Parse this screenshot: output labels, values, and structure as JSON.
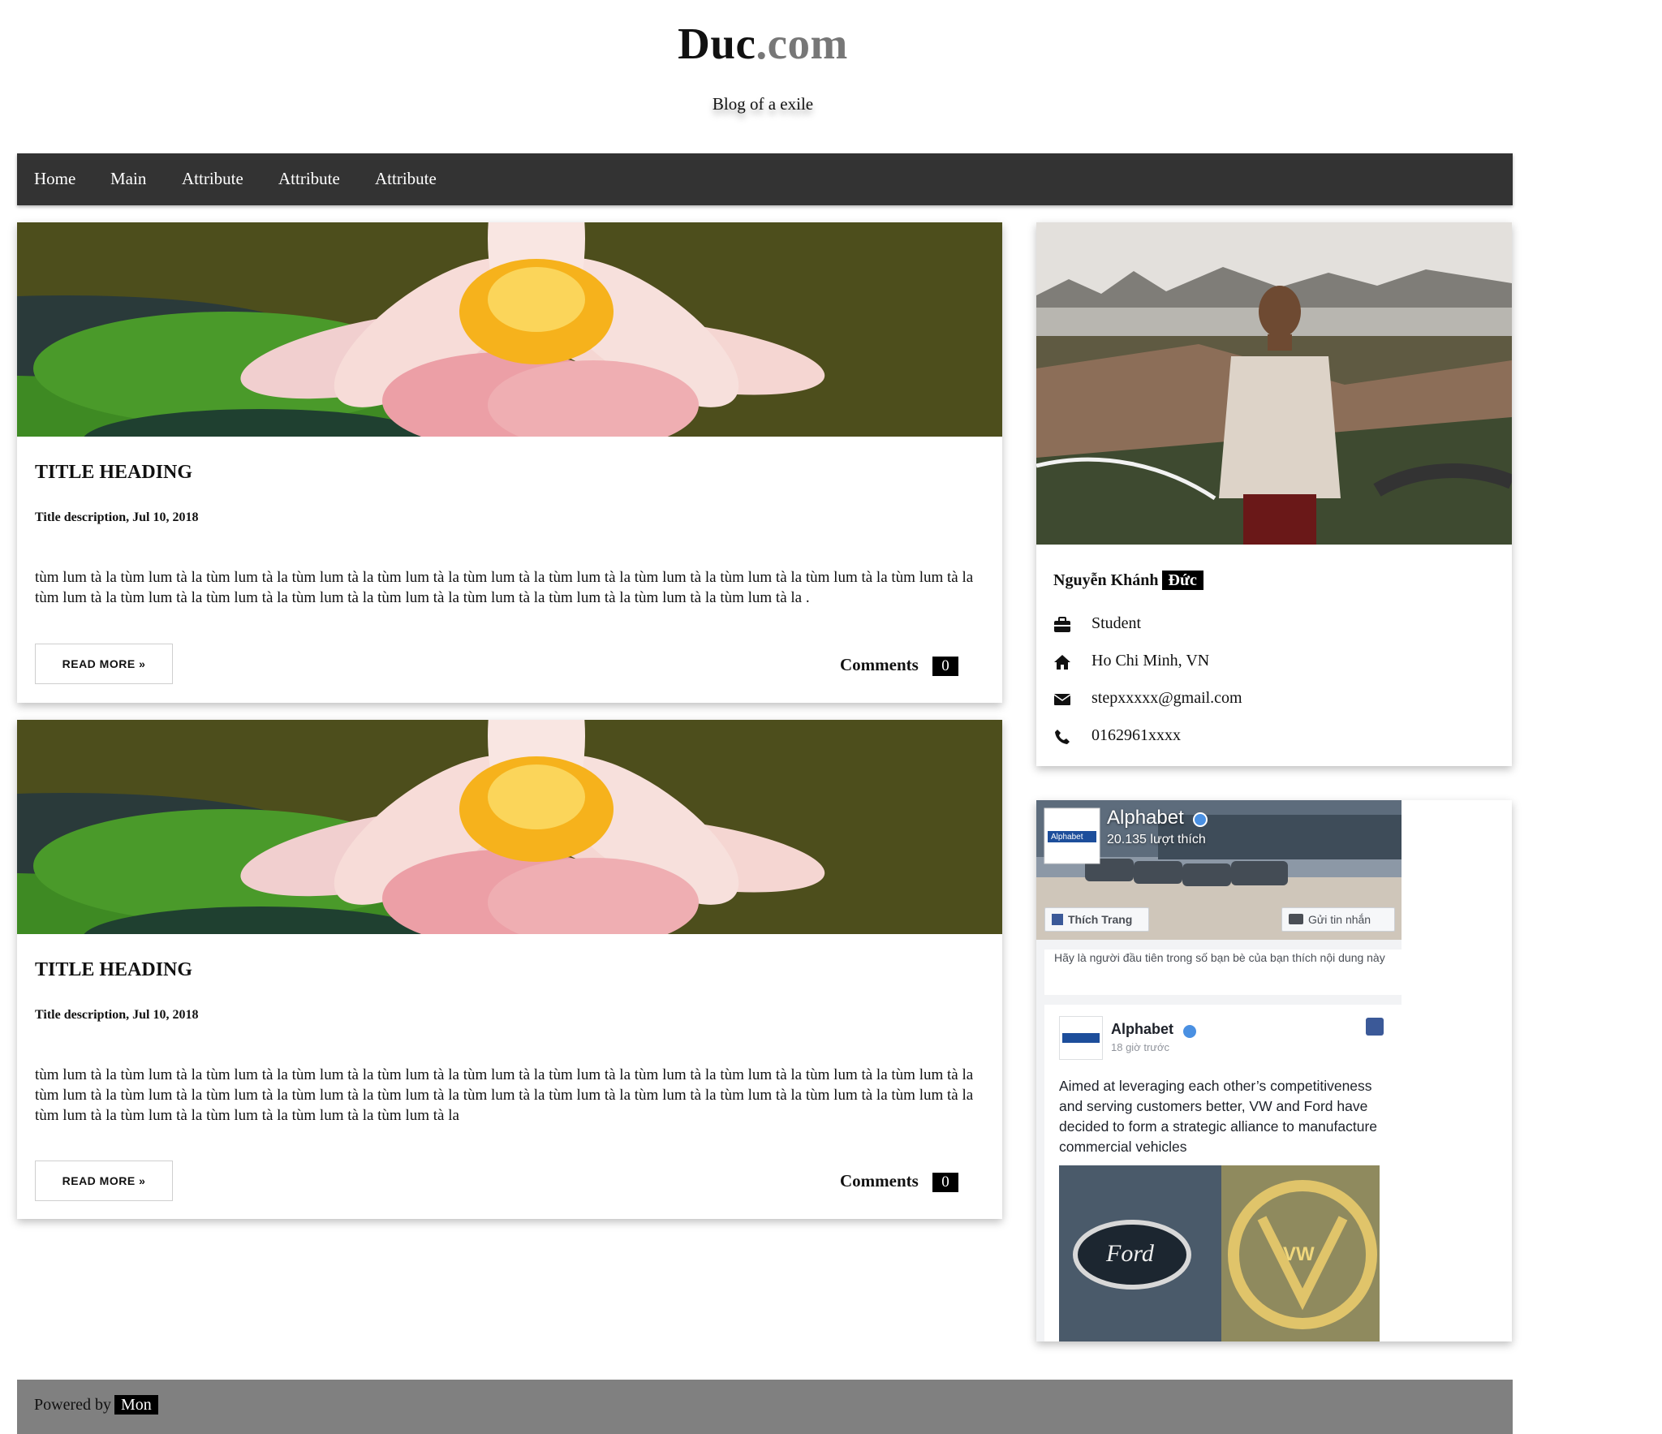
{
  "site": {
    "title_main": "Duc",
    "title_ext": ".com",
    "tagline": "Blog of a exile"
  },
  "nav": {
    "items": [
      "Home",
      "Main",
      "Attribute",
      "Attribute",
      "Attribute"
    ]
  },
  "posts": [
    {
      "title": "TITLE HEADING",
      "description": "Title description, Jul 10, 2018",
      "body": "tùm lum tà la tùm lum tà la tùm lum tà la tùm lum tà la tùm lum tà la tùm lum tà la tùm lum tà la tùm lum tà la tùm lum tà la tùm lum tà la tùm lum tà la tùm lum tà la tùm lum tà la tùm lum tà la tùm lum tà la tùm lum tà la tùm lum tà la tùm lum tà la tùm lum tà la tùm lum tà la .",
      "read_more": "READ MORE »",
      "comments_label": "Comments",
      "comments_count": "0"
    },
    {
      "title": "TITLE HEADING",
      "description": "Title description, Jul 10, 2018",
      "body": "tùm lum tà la tùm lum tà la tùm lum tà la tùm lum tà la tùm lum tà la tùm lum tà la tùm lum tà la tùm lum tà la tùm lum tà la tùm lum tà la tùm lum tà la tùm lum tà la tùm lum tà la tùm lum tà la tùm lum tà la tùm lum tà la tùm lum tà la tùm lum tà la tùm lum tà la tùm lum tà la tùm lum tà la tùm lum tà la tùm lum tà la tùm lum tà la tùm lum tà la tùm lum tà la tùm lum tà la",
      "read_more": "READ MORE »",
      "comments_label": "Comments",
      "comments_count": "0"
    }
  ],
  "profile": {
    "name_first": "Nguyễn Khánh",
    "name_badge": "Đức",
    "occupation": "Student",
    "location": "Ho Chi Minh, VN",
    "email": "stepxxxxx@gmail.com",
    "phone": "0162961xxxx"
  },
  "fb_widget": {
    "page_name": "Alphabet",
    "page_logo_text": "Alphabet",
    "likes": "20.135 lượt thích",
    "like_button": "Thích Trang",
    "message_button": "Gửi tin nhắn",
    "friends_prompt": "Hãy là người đầu tiên trong số bạn bè của bạn thích nội dung này",
    "post_author": "Alphabet",
    "post_time": "18 giờ trước",
    "post_text": "Aimed at leveraging each other’s competitiveness and serving customers better, VW and Ford have decided to form a strategic alliance to manufacture commercial vehicles",
    "post_image_text_left": "Ford",
    "post_image_text_right": "VW"
  },
  "footer": {
    "powered_by": "Powered by",
    "brand": "Mon"
  },
  "colors": {
    "nav_bg": "#333333",
    "footer_bg": "#808080",
    "badge_bg": "#000000",
    "fb_blue": "#3b5998"
  },
  "icons": [
    "briefcase-icon",
    "home-icon",
    "envelope-icon",
    "phone-icon",
    "verified-icon",
    "facebook-icon",
    "messenger-icon"
  ]
}
